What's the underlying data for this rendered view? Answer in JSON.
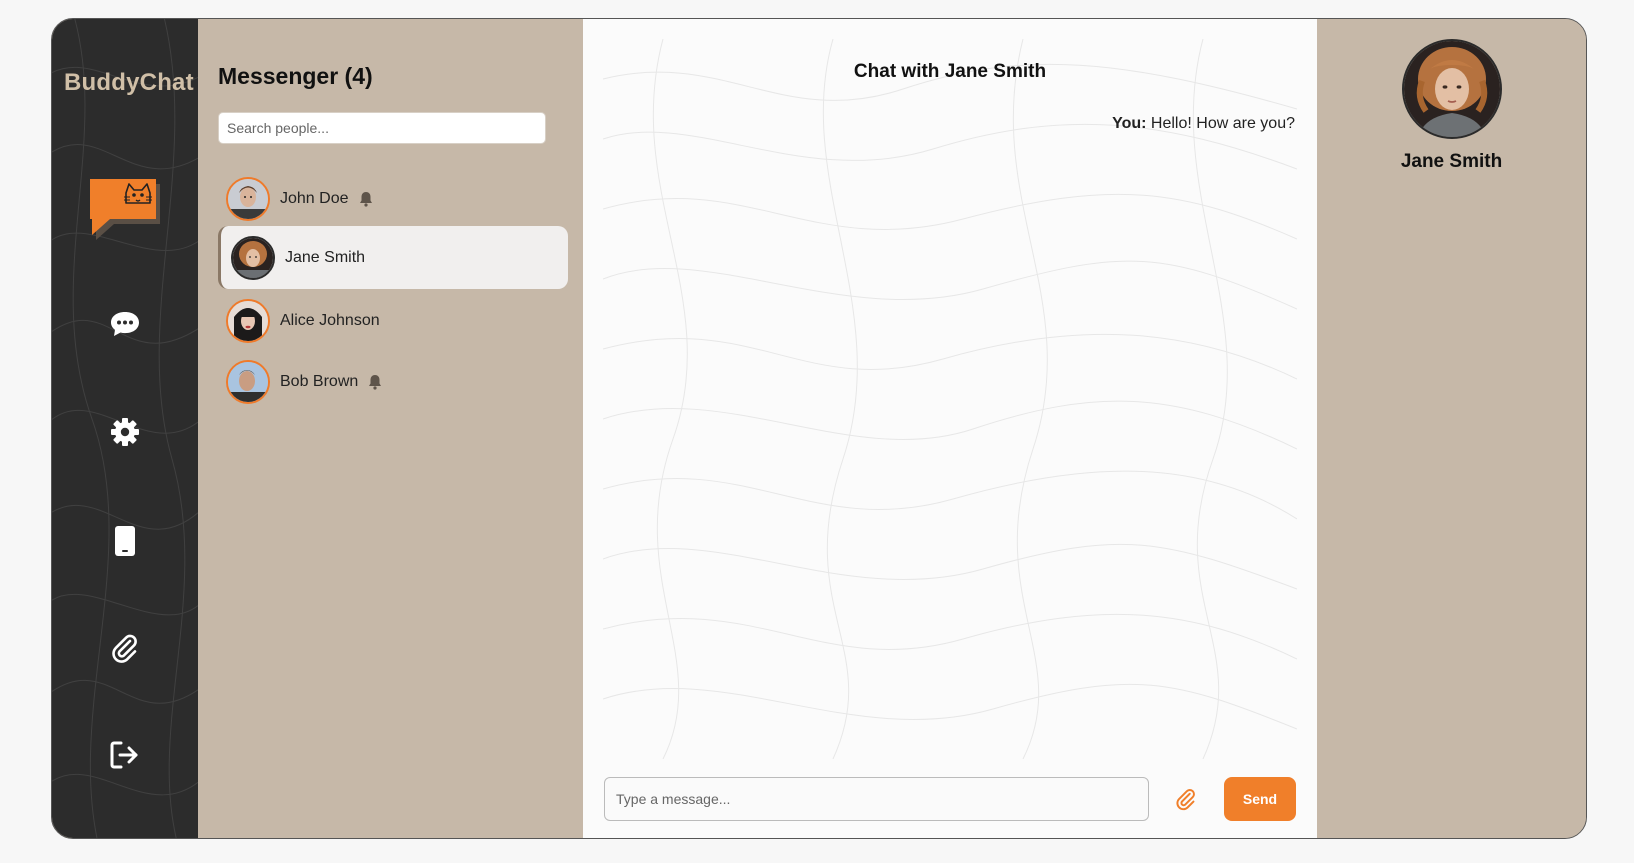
{
  "app": {
    "brand": "BuddyChat"
  },
  "nav": {
    "items": [
      {
        "name": "chat-bubble-icon"
      },
      {
        "name": "gear-icon"
      },
      {
        "name": "mobile-device-icon"
      },
      {
        "name": "paperclip-icon"
      },
      {
        "name": "logout-icon"
      }
    ]
  },
  "messenger": {
    "title": "Messenger (4)",
    "search_placeholder": "Search people...",
    "contacts": [
      {
        "name": "John Doe",
        "notify": true,
        "active": false
      },
      {
        "name": "Jane Smith",
        "notify": false,
        "active": true
      },
      {
        "name": "Alice Johnson",
        "notify": false,
        "active": false
      },
      {
        "name": "Bob Brown",
        "notify": true,
        "active": false
      }
    ]
  },
  "chat": {
    "title": "Chat with Jane Smith",
    "messages": [
      {
        "sender": "You:",
        "text": "Hello! How are you?"
      }
    ],
    "input_placeholder": "Type a message...",
    "send_label": "Send"
  },
  "profile": {
    "name": "Jane Smith"
  },
  "colors": {
    "accent": "#f07f2a",
    "rail": "#2c2c2c",
    "panel": "#c6b8a8",
    "chat_bg": "#fbfbfb",
    "brand_text": "#d0bfa7"
  }
}
